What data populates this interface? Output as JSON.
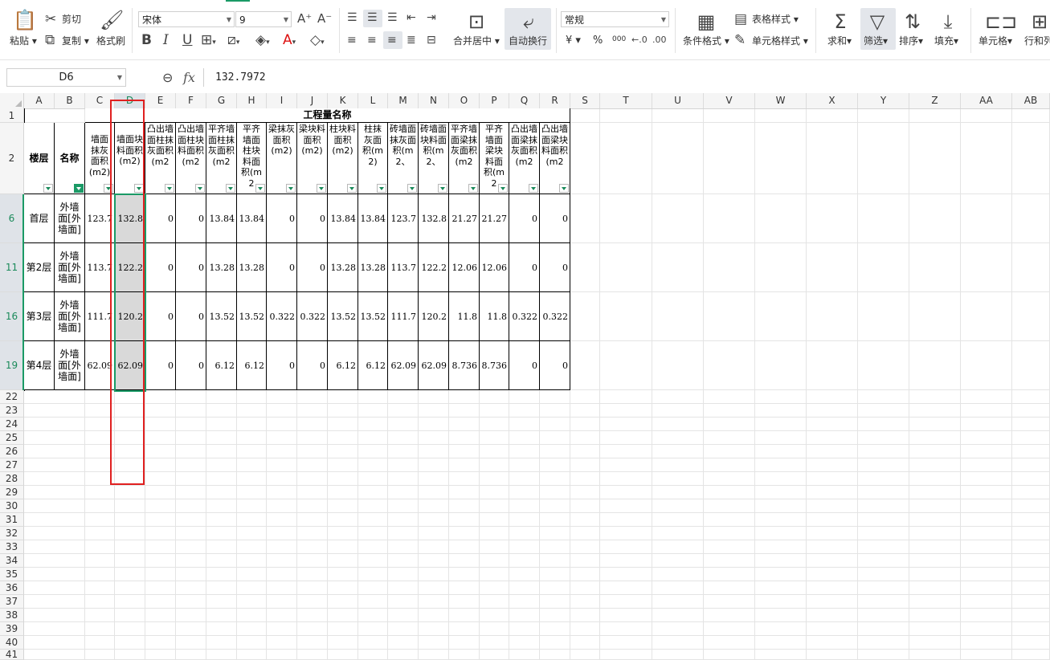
{
  "ribbon": {
    "paste": "粘贴",
    "cut": "剪切",
    "copy": "复制",
    "format_painter": "格式刷",
    "font_name": "宋体",
    "font_size": "9",
    "bold": "B",
    "italic": "I",
    "underline": "U",
    "merge_center": "合并居中",
    "wrap_text": "自动换行",
    "number_format": "常规",
    "currency": "¥",
    "percent": "%",
    "thousands": "000",
    "conditional_format": "条件格式",
    "table_style": "表格样式",
    "cell_style": "单元格样式",
    "sum": "求和",
    "filter": "筛选",
    "sort": "排序",
    "fill": "填充",
    "cell": "单元格",
    "row_col": "行和列"
  },
  "formula_bar": {
    "name_box": "D6",
    "fx": "fx",
    "formula": "132.7972"
  },
  "columns": [
    "A",
    "B",
    "C",
    "D",
    "E",
    "F",
    "G",
    "H",
    "I",
    "J",
    "K",
    "L",
    "M",
    "N",
    "O",
    "P",
    "Q",
    "R",
    "S",
    "T",
    "U",
    "V",
    "W",
    "X",
    "Y",
    "Z",
    "AA",
    "AB"
  ],
  "rows": [
    "1",
    "2",
    "6",
    "11",
    "16",
    "19",
    "22",
    "23",
    "24",
    "25",
    "26",
    "27",
    "28",
    "29",
    "30",
    "31",
    "32",
    "33",
    "34",
    "35",
    "36",
    "37",
    "38",
    "39",
    "40",
    "41"
  ],
  "table": {
    "group_title": "工程量名称",
    "col_floor": "楼层",
    "col_name": "名称",
    "headers": [
      "墙面抹灰面积(m2)",
      "墙面块料面积(m2)",
      "凸出墙面柱抹灰面积(m2",
      "凸出墙面柱块料面积(m2",
      "平齐墙面柱抹灰面积(m2",
      "平齐墙面柱块料面积(m2",
      "梁抹灰面积(m2)",
      "梁块料面积(m2)",
      "柱块料面积(m2)",
      "柱抹灰面积(m2)",
      "砖墙面抹灰面积(m2、",
      "砖墙面块料面积(m2、",
      "平齐墙面梁抹灰面积(m2",
      "平齐墙面梁块料面积(m2",
      "凸出墙面梁抹灰面积(m2",
      "凸出墙面梁块料面积(m2"
    ],
    "rows": [
      {
        "floor": "首层",
        "name": "外墙面[外墙面]",
        "values": [
          "123.7",
          "132.8",
          "0",
          "0",
          "13.84",
          "13.84",
          "0",
          "0",
          "13.84",
          "13.84",
          "123.7",
          "132.8",
          "21.27",
          "21.27",
          "0",
          "0"
        ]
      },
      {
        "floor": "第2层",
        "name": "外墙面[外墙面]",
        "values": [
          "113.7",
          "122.2",
          "0",
          "0",
          "13.28",
          "13.28",
          "0",
          "0",
          "13.28",
          "13.28",
          "113.7",
          "122.2",
          "12.06",
          "12.06",
          "0",
          "0"
        ]
      },
      {
        "floor": "第3层",
        "name": "外墙面[外墙面]",
        "values": [
          "111.7",
          "120.2",
          "0",
          "0",
          "13.52",
          "13.52",
          "0.322",
          "0.322",
          "13.52",
          "13.52",
          "111.7",
          "120.2",
          "11.8",
          "11.8",
          "0.322",
          "0.322"
        ]
      },
      {
        "floor": "第4层",
        "name": "外墙面[外墙面]",
        "values": [
          "62.09",
          "62.09",
          "0",
          "0",
          "6.12",
          "6.12",
          "0",
          "0",
          "6.12",
          "6.12",
          "62.09",
          "62.09",
          "8.736",
          "8.736",
          "0",
          "0"
        ]
      }
    ]
  },
  "colors": {
    "accent": "#1a9a66",
    "highlight_box": "#e02020",
    "selection_fill": "#d9d9d9",
    "header_bg": "#f5f5f5"
  }
}
